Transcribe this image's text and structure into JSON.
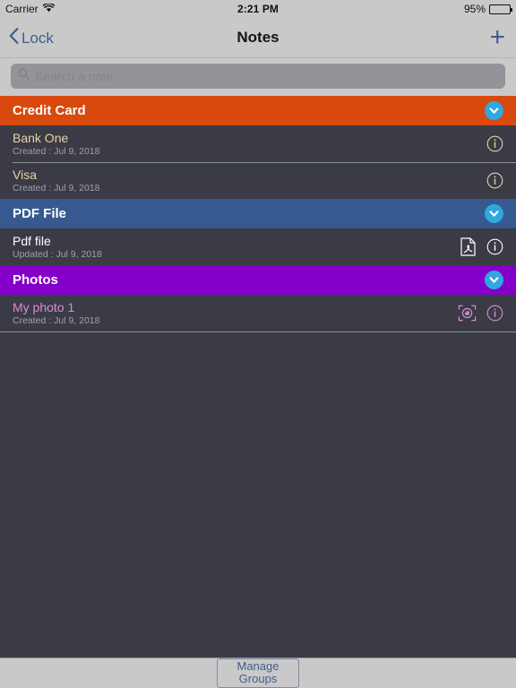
{
  "status_bar": {
    "carrier": "Carrier",
    "wifi_icon": "wifi-icon",
    "time": "2:21 PM",
    "battery_percent": "95%",
    "battery_level": 95,
    "battery_icon": "battery-icon"
  },
  "nav_bar": {
    "back_icon": "chevron-left-icon",
    "back_label": "Lock",
    "title": "Notes",
    "add_icon": "plus-icon",
    "add_label": "+"
  },
  "search": {
    "icon": "search-icon",
    "placeholder": "Search a note",
    "value": ""
  },
  "colors": {
    "credit_card_header": "#d8490e",
    "pdf_header": "#36598f",
    "photos_header": "#8400c8",
    "list_background": "#3a3b45",
    "chevron_circle": "#2fa8e0",
    "chrome": "#c9c9c9",
    "tint_blue": "#3f5d8e",
    "credit_card_text": "#e6d4a4",
    "pdf_text": "#ffffff",
    "photos_text": "#d98cd6"
  },
  "groups": [
    {
      "name": "Credit Card",
      "header_color": "#d8490e",
      "text_color": "#e6d4a4",
      "collapse_icon": "chevron-down-circle-icon",
      "items": [
        {
          "title": "Bank One",
          "subtitle": "Created : Jul 9, 2018",
          "icons": [
            "info-icon"
          ]
        },
        {
          "title": "Visa",
          "subtitle": "Created : Jul 9, 2018",
          "icons": [
            "info-icon"
          ]
        }
      ]
    },
    {
      "name": "PDF File",
      "header_color": "#36598f",
      "text_color": "#ffffff",
      "collapse_icon": "chevron-down-circle-icon",
      "items": [
        {
          "title": "Pdf file",
          "subtitle": "Updated : Jul 9, 2018",
          "icons": [
            "pdf-document-icon",
            "info-icon"
          ]
        }
      ]
    },
    {
      "name": "Photos",
      "header_color": "#8400c8",
      "text_color": "#d98cd6",
      "collapse_icon": "chevron-down-circle-icon",
      "items": [
        {
          "title": "My photo 1",
          "subtitle": "Created : Jul 9, 2018",
          "icons": [
            "camera-viewfinder-icon",
            "info-icon"
          ]
        }
      ]
    }
  ],
  "toolbar": {
    "manage_line1": "Manage",
    "manage_line2": "Groups"
  }
}
